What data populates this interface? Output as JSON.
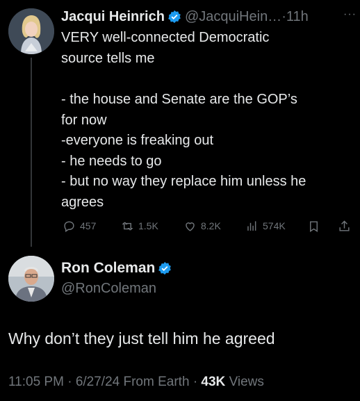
{
  "tweet": {
    "author_name": "Jacqui Heinrich",
    "author_handle": "@JacquiHein…",
    "separator": "·",
    "time": "11h",
    "more_label": "···",
    "text_lines_a": [
      "VERY well-connected Democratic",
      "source tells me"
    ],
    "text_lines_b": [
      "- the house and Senate are the GOP’s",
      "for now",
      "-everyone is freaking out",
      "- he needs to go",
      "- but no way they replace him unless he",
      "agrees"
    ],
    "actions": {
      "replies": "457",
      "reposts": "1.5K",
      "likes": "8.2K",
      "views": "574K"
    }
  },
  "reply": {
    "author_name": "Ron Coleman",
    "author_handle": "@RonColeman",
    "text": "Why don’t they just tell him he agreed",
    "time": "11:05 PM",
    "date": "6/27/24",
    "source": "From Earth",
    "views_count": "43K",
    "views_label": "Views",
    "dot": "·"
  },
  "colors": {
    "background": "#000000",
    "text_primary": "#e7e9ea",
    "text_secondary": "#71767b",
    "verified": "#1d9bf0"
  }
}
